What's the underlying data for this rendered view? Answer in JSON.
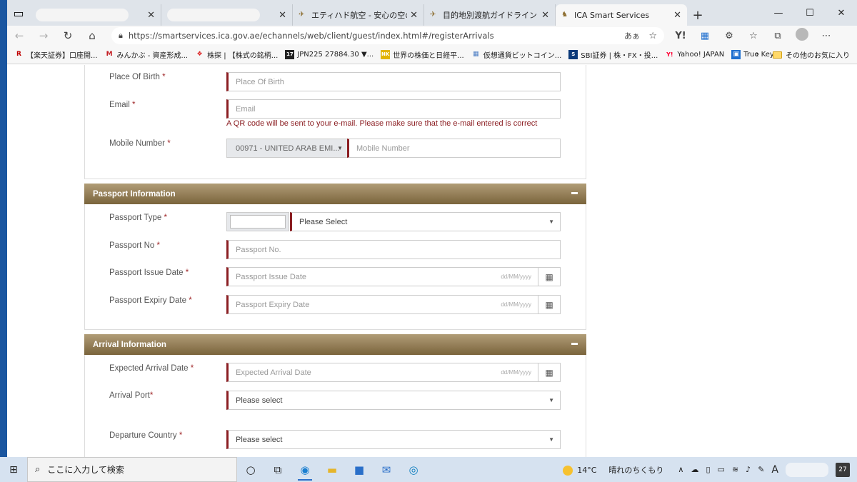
{
  "browser": {
    "tabs": [
      {
        "title": "",
        "redacted": true
      },
      {
        "title": "",
        "redacted": true
      },
      {
        "title": "エティハド航空 - 安心の空の旅"
      },
      {
        "title": "目的地別渡航ガイドライン - エティハ"
      },
      {
        "title": "ICA Smart Services",
        "active": true
      }
    ],
    "url": "https://smartservices.ica.gov.ae/echannels/web/client/guest/index.html#/registerArrivals",
    "read_aloud": "あぁ",
    "bookmarks": [
      {
        "label": "【楽天証券】口座開...",
        "icon": "R",
        "color": "#bf0000"
      },
      {
        "label": "みんかぶ - 資産形成...",
        "icon": "M",
        "color": "#c41e24"
      },
      {
        "label": "株探 | 【株式の銘柄...",
        "icon": "k",
        "color": "#d22"
      },
      {
        "label": "JPN225 27884.30 ▼...",
        "icon": "17",
        "color": "#222"
      },
      {
        "label": "世界の株価と日経平...",
        "icon": "NK",
        "color": "#e2b400"
      },
      {
        "label": "仮想通貨ビットコイン...",
        "icon": "▦",
        "color": "#4a7cc4"
      },
      {
        "label": "SBI証券 | 株・FX・投...",
        "icon": "S",
        "color": "#0b3a7a"
      },
      {
        "label": "Yahoo! JAPAN",
        "icon": "Y!",
        "color": "#ff0033"
      },
      {
        "label": "True Key",
        "icon": "▣",
        "color": "#1f6fcf"
      }
    ],
    "other_favorites": "その他のお気に入り"
  },
  "form": {
    "required_mark": "*",
    "personal": {
      "place_of_birth": {
        "label": "Place Of Birth",
        "placeholder": "Place Of Birth"
      },
      "email": {
        "label": "Email",
        "placeholder": "Email",
        "note": "A QR code will be sent to your e-mail. Please make sure that the e-mail entered is correct"
      },
      "mobile": {
        "label": "Mobile Number",
        "country_code": "00971 - UNITED ARAB EMI...",
        "placeholder": "Mobile Number"
      }
    },
    "passport": {
      "title": "Passport Information",
      "type": {
        "label": "Passport Type",
        "value": "Please Select"
      },
      "number": {
        "label": "Passport No",
        "placeholder": "Passport No."
      },
      "issue_date": {
        "label": "Passport Issue Date",
        "placeholder": "Passport Issue Date",
        "format": "dd/MM/yyyy"
      },
      "expiry_date": {
        "label": "Passport Expiry Date",
        "placeholder": "Passport Expiry Date",
        "format": "dd/MM/yyyy"
      }
    },
    "arrival": {
      "title": "Arrival Information",
      "expected_date": {
        "label": "Expected Arrival Date",
        "placeholder": "Expected Arrival Date",
        "format": "dd/MM/yyyy"
      },
      "port": {
        "label": "Arrival Port",
        "value": "Please select"
      },
      "departure_country": {
        "label": "Departure Country",
        "value": "Please select"
      }
    }
  },
  "taskbar": {
    "search_placeholder": "ここに入力して検索",
    "temperature": "14°C",
    "weather": "晴れのちくもり",
    "ime": "A",
    "notifications": "27"
  }
}
